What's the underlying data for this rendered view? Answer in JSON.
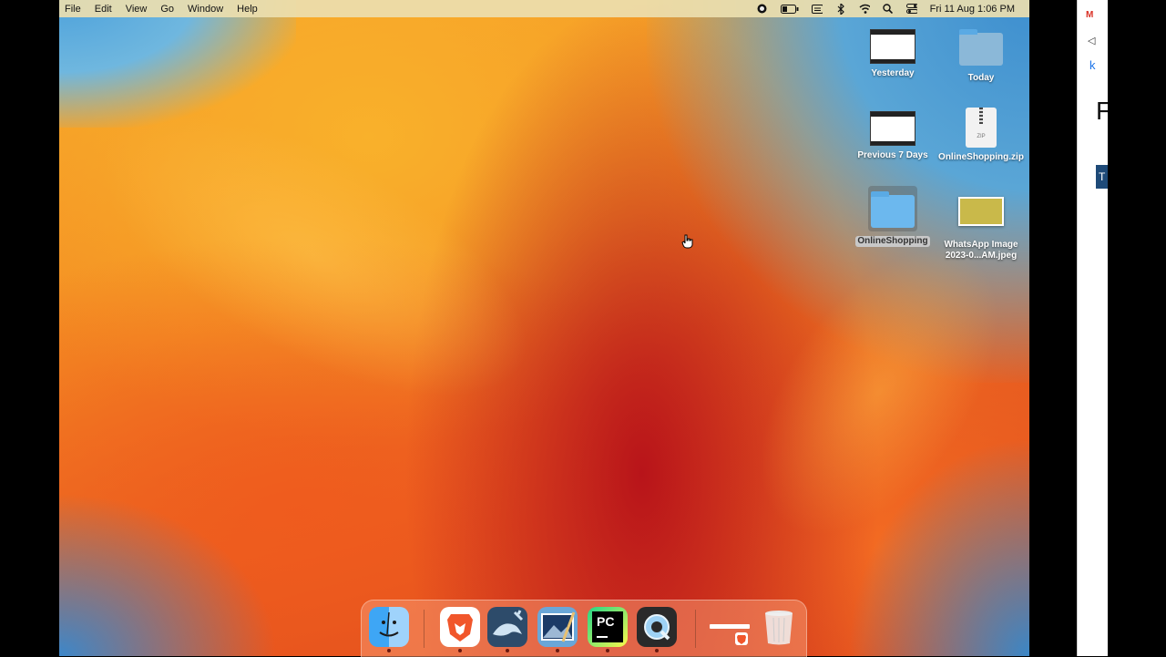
{
  "menubar": {
    "items": [
      "File",
      "Edit",
      "View",
      "Go",
      "Window",
      "Help"
    ],
    "clock": "Fri 11 Aug  1:06 PM"
  },
  "desktop_icons": [
    {
      "label": "Yesterday",
      "kind": "screenshot"
    },
    {
      "label": "Today",
      "kind": "folder"
    },
    {
      "label": "Previous 7 Days",
      "kind": "screenshot"
    },
    {
      "label": "OnlineShopping.zip",
      "kind": "zip"
    },
    {
      "label": "OnlineShopping",
      "kind": "folder",
      "selected": true
    },
    {
      "label": "WhatsApp Image 2023-0...AM.jpeg",
      "kind": "image"
    }
  ],
  "dock": {
    "apps": [
      {
        "name": "finder-icon",
        "glyph": "☺"
      },
      {
        "name": "brave-icon",
        "glyph": "🦁"
      },
      {
        "name": "mysql-workbench-icon",
        "glyph": "🐬"
      },
      {
        "name": "preview-icon",
        "glyph": "🏔"
      },
      {
        "name": "pycharm-icon",
        "glyph": "PC"
      },
      {
        "name": "quicktime-icon",
        "glyph": "Q"
      }
    ]
  },
  "right_window": {
    "tab_letters": "M",
    "link_letter": "k",
    "heading_letter": "F",
    "bar_letter": "T"
  }
}
